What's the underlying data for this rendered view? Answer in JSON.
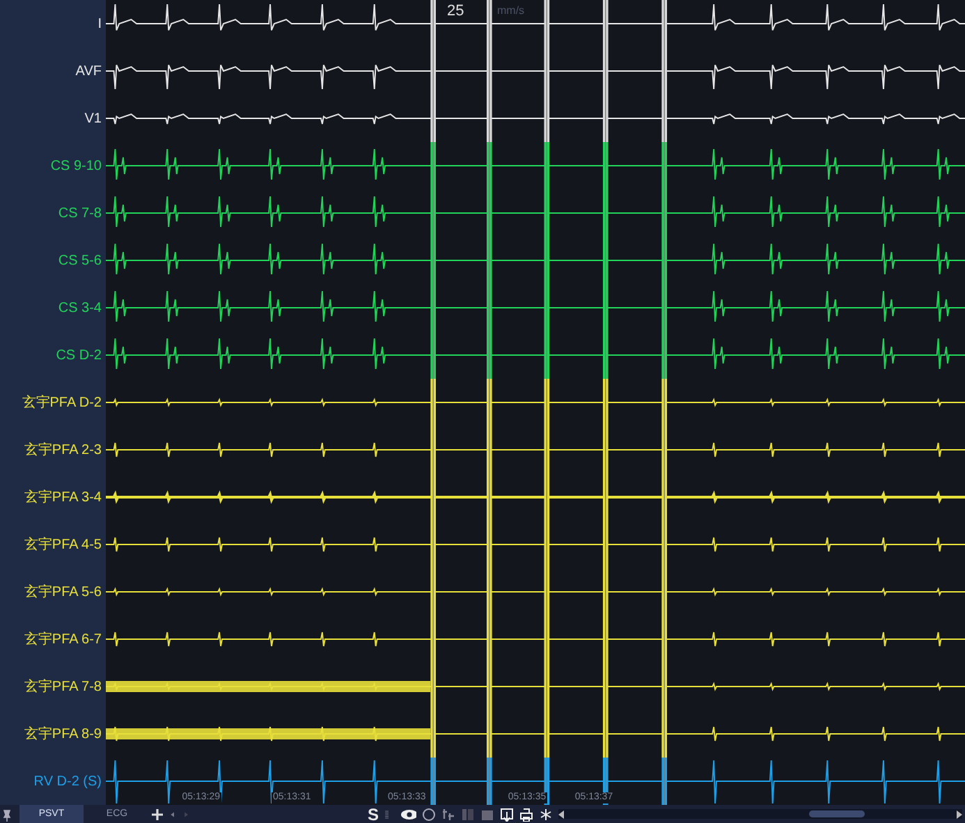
{
  "speed": {
    "value": "25",
    "unit": "mm/s"
  },
  "channels": [
    {
      "label": "I",
      "color": "#e6e6e6",
      "kind": "surface",
      "noise": false
    },
    {
      "label": "AVF",
      "color": "#e6e6e6",
      "kind": "surface",
      "noise": false
    },
    {
      "label": "V1",
      "color": "#e6e6e6",
      "kind": "surface",
      "noise": false
    },
    {
      "label": "CS 9-10",
      "color": "#22d35a",
      "kind": "cs",
      "noise": false
    },
    {
      "label": "CS 7-8",
      "color": "#22d35a",
      "kind": "cs",
      "noise": false
    },
    {
      "label": "CS 5-6",
      "color": "#22d35a",
      "kind": "cs",
      "noise": false
    },
    {
      "label": "CS 3-4",
      "color": "#22d35a",
      "kind": "cs",
      "noise": false
    },
    {
      "label": "CS D-2",
      "color": "#22d35a",
      "kind": "cs",
      "noise": false
    },
    {
      "label": "玄宇PFA D-2",
      "color": "#e8e03a",
      "kind": "pfa",
      "noise": false
    },
    {
      "label": "玄宇PFA 2-3",
      "color": "#e8e03a",
      "kind": "pfa",
      "noise": false
    },
    {
      "label": "玄宇PFA 3-4",
      "color": "#e8e03a",
      "kind": "pfa",
      "noise": false
    },
    {
      "label": "玄宇PFA 4-5",
      "color": "#e8e03a",
      "kind": "pfa",
      "noise": false
    },
    {
      "label": "玄宇PFA 5-6",
      "color": "#e8e03a",
      "kind": "pfa",
      "noise": false
    },
    {
      "label": "玄宇PFA 6-7",
      "color": "#e8e03a",
      "kind": "pfa",
      "noise": false
    },
    {
      "label": "玄宇PFA 7-8",
      "color": "#e8e03a",
      "kind": "pfa",
      "noise": true
    },
    {
      "label": "玄宇PFA 8-9",
      "color": "#e8e03a",
      "kind": "pfa",
      "noise": true
    },
    {
      "label": "RV D-2 (S)",
      "color": "#1e9fe6",
      "kind": "rv",
      "noise": false
    }
  ],
  "times": [
    "05:13:29",
    "05:13:31",
    "05:13:33",
    "05:13:35",
    "05:13:37"
  ],
  "tabs": [
    {
      "label": "PSVT",
      "selected": true
    },
    {
      "label": "ECG",
      "selected": false
    }
  ],
  "toolbar_letter": "S"
}
